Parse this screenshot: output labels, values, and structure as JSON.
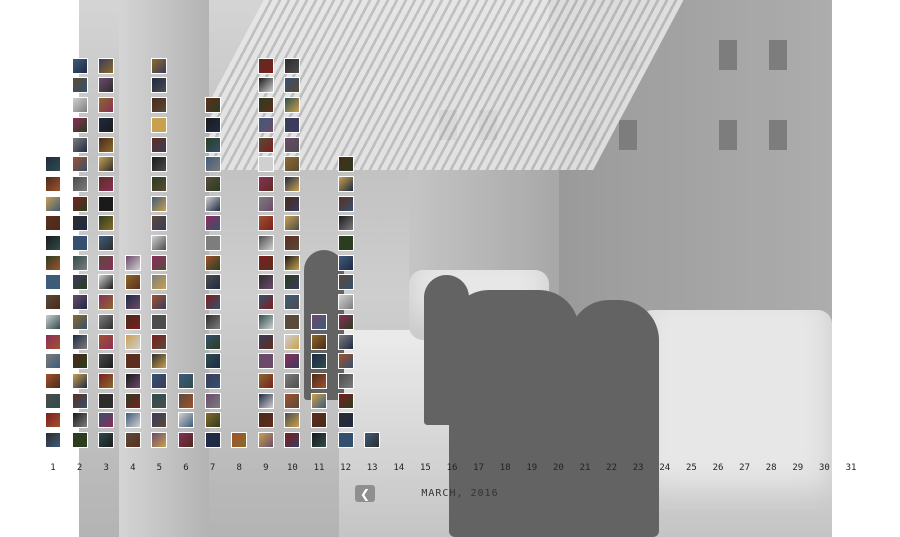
{
  "month_label": "MARCH, 2016",
  "nav": {
    "prev_icon": "chevron-left-icon",
    "prev_glyph": "❮"
  },
  "days": [
    "1",
    "2",
    "3",
    "4",
    "5",
    "6",
    "7",
    "8",
    "9",
    "10",
    "11",
    "12",
    "13",
    "14",
    "15",
    "16",
    "17",
    "18",
    "19",
    "20",
    "21",
    "22",
    "23",
    "24",
    "25",
    "26",
    "27",
    "28",
    "29",
    "30",
    "31"
  ],
  "photo_counts": [
    15,
    20,
    20,
    10,
    20,
    4,
    18,
    1,
    20,
    20,
    7,
    15,
    1,
    0,
    0,
    0,
    0,
    0,
    0,
    0,
    0,
    0,
    0,
    0,
    0,
    0,
    0,
    0,
    0,
    0,
    0
  ],
  "background_photo": {
    "description_icon": "street-photo",
    "tone": "greyscale"
  },
  "thumb_palette": [
    "#2d2d2d",
    "#5a4a3a",
    "#1f2a44",
    "#7a1f1f",
    "#3e5b7a",
    "#8a6a2a",
    "#4c4c4c",
    "#2a3d1f",
    "#6b4a6b",
    "#a0522d",
    "#1a1a1a",
    "#3b3b5c",
    "#7d7d7d",
    "#5c2e1f",
    "#2e4d4d",
    "#8b2d5c",
    "#c8a050",
    "#35506e",
    "#d0d0d0",
    "#4a2a1a"
  ]
}
